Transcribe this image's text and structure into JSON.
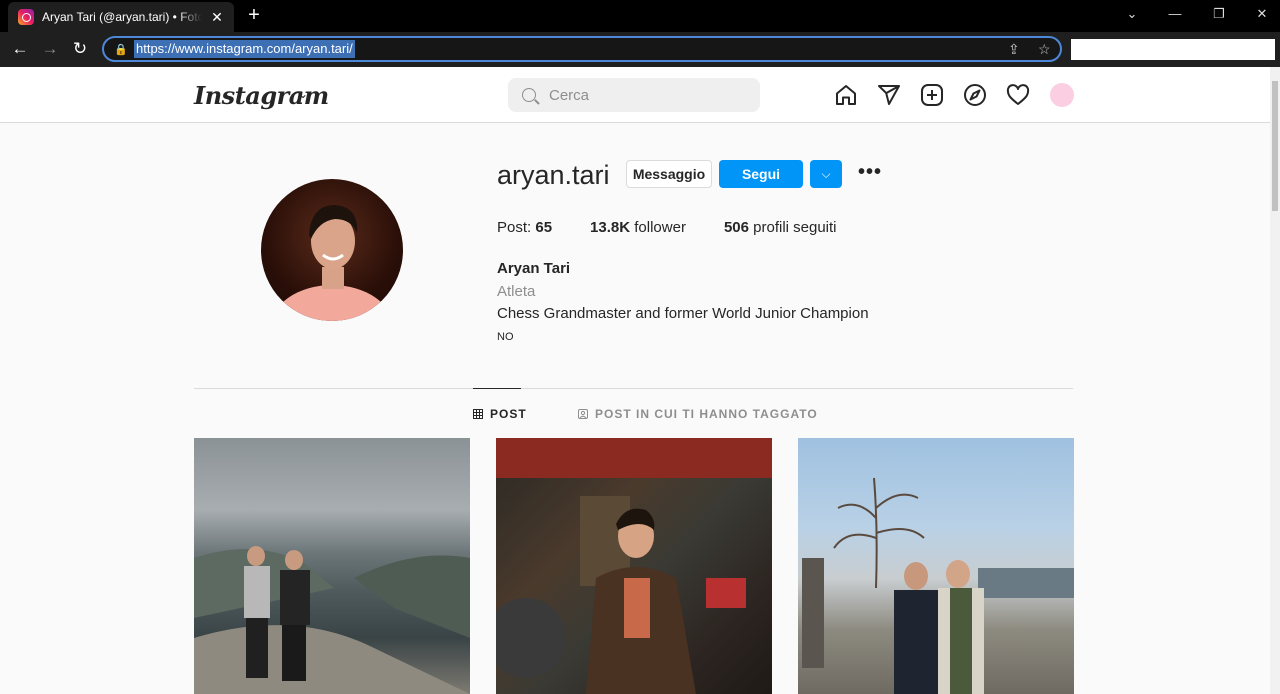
{
  "browser": {
    "tab_title": "Aryan Tari (@aryan.tari) • Foto e video di Instagram",
    "url": "https://www.instagram.com/aryan.tari/"
  },
  "header": {
    "logo": "Instagram",
    "search_placeholder": "Cerca"
  },
  "profile": {
    "username": "aryan.tari",
    "message_button": "Messaggio",
    "follow_button": "Segui",
    "stats": {
      "posts_label": "Post:",
      "posts_value": "65",
      "followers_value": "13.8K",
      "followers_label": "follower",
      "following_value": "506",
      "following_label": "profili seguiti"
    },
    "full_name": "Aryan Tari",
    "category": "Atleta",
    "bio": "Chess Grandmaster and former World Junior Champion",
    "bio_line2": "NO"
  },
  "tabs": [
    {
      "label": "POST",
      "active": true
    },
    {
      "label": "POST IN CUI TI HANNO TAGGATO",
      "active": false
    }
  ],
  "colors": {
    "accent": "#0095f6",
    "text": "#262626",
    "muted": "#8e8e8e"
  }
}
